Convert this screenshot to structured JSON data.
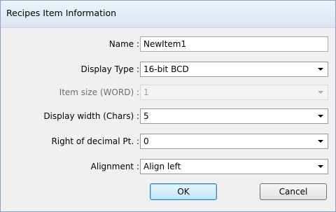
{
  "window": {
    "title": "Recipes Item Information"
  },
  "form": {
    "name": {
      "label": "Name :",
      "value": "NewItem1"
    },
    "display_type": {
      "label": "Display Type :",
      "value": "16-bit BCD"
    },
    "item_size": {
      "label": "Item size (WORD) :",
      "value": "1"
    },
    "display_width": {
      "label": "Display width (Chars) :",
      "value": "5"
    },
    "decimal_pt": {
      "label": "Right of decimal Pt. :",
      "value": "0"
    },
    "alignment": {
      "label": "Alignment :",
      "value": "Align left"
    }
  },
  "buttons": {
    "ok_label": "OK",
    "cancel_label": "Cancel"
  },
  "icons": {
    "dropdown": "chevron-down-icon"
  },
  "colors": {
    "titlebar": "#dae4f2",
    "dialog_bg": "#f0f0f0",
    "default_button": "#bee6fd"
  }
}
